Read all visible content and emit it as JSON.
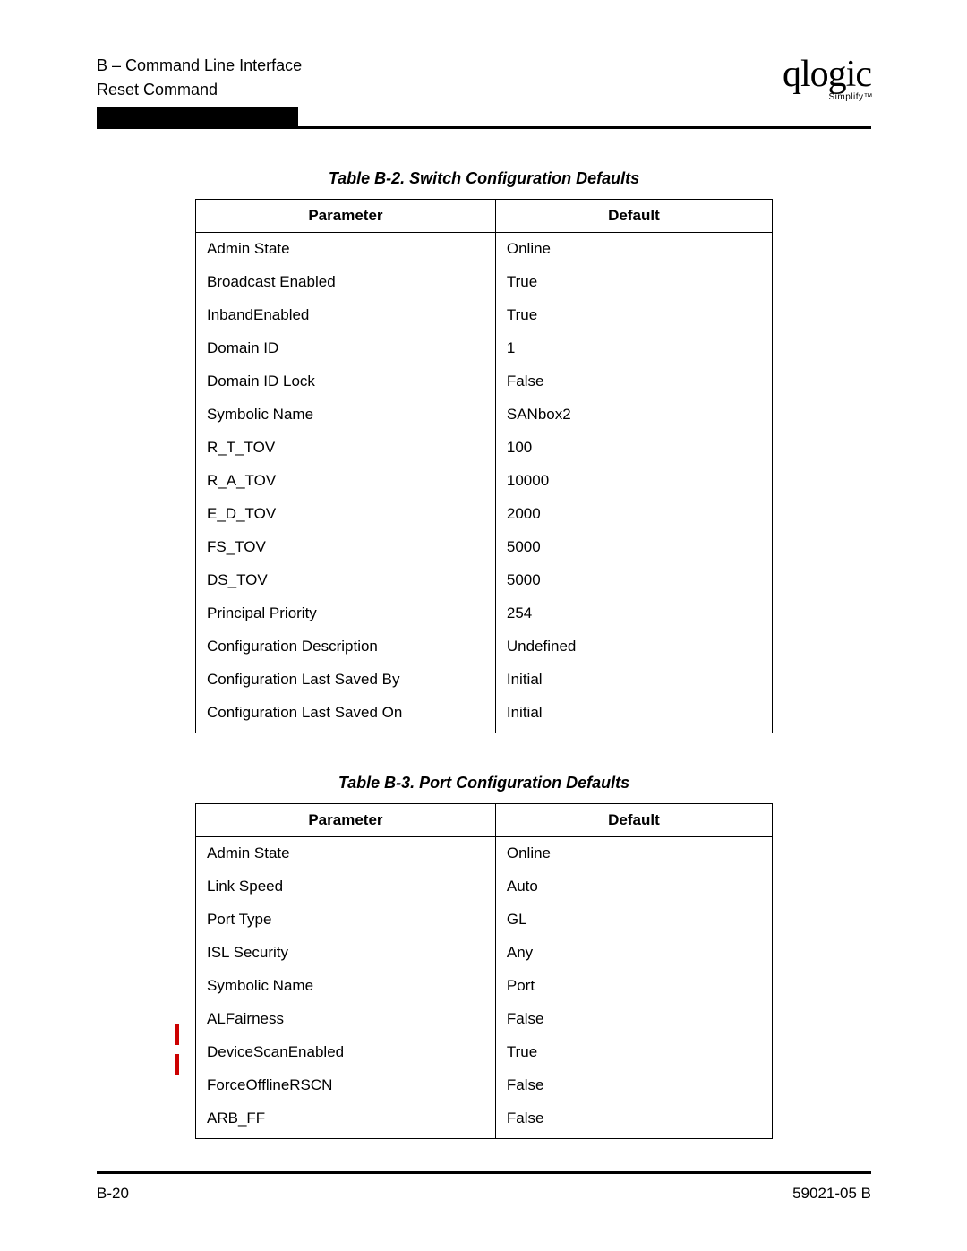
{
  "header": {
    "section": "B – Command Line Interface",
    "title": "Reset Command",
    "brand": "qlogic",
    "brand_sub": "Simplify™"
  },
  "tables": [
    {
      "caption": "Table B-2. Switch Configuration Defaults",
      "col1": "Parameter",
      "col2": "Default",
      "rows": [
        {
          "param": "Admin State",
          "default": "Online"
        },
        {
          "param": "Broadcast Enabled",
          "default": "True"
        },
        {
          "param": "InbandEnabled",
          "default": "True"
        },
        {
          "param": "Domain ID",
          "default": "1"
        },
        {
          "param": "Domain ID Lock",
          "default": "False"
        },
        {
          "param": "Symbolic Name",
          "default": "SANbox2"
        },
        {
          "param": "R_T_TOV",
          "default": "100"
        },
        {
          "param": "R_A_TOV",
          "default": "10000"
        },
        {
          "param": "E_D_TOV",
          "default": "2000"
        },
        {
          "param": "FS_TOV",
          "default": "5000"
        },
        {
          "param": "DS_TOV",
          "default": "5000"
        },
        {
          "param": "Principal Priority",
          "default": "254"
        },
        {
          "param": "Configuration Description",
          "default": "Undefined"
        },
        {
          "param": "Configuration Last Saved By",
          "default": "Initial"
        },
        {
          "param": "Configuration Last Saved On",
          "default": "Initial"
        }
      ]
    },
    {
      "caption": "Table B-3. Port Configuration Defaults",
      "col1": "Parameter",
      "col2": "Default",
      "rows": [
        {
          "param": "Admin State",
          "default": "Online"
        },
        {
          "param": "Link Speed",
          "default": "Auto"
        },
        {
          "param": "Port Type",
          "default": "GL"
        },
        {
          "param": "ISL Security",
          "default": "Any"
        },
        {
          "param": "Symbolic Name",
          "default": "Port"
        },
        {
          "param": "ALFairness",
          "default": "False"
        },
        {
          "param": "DeviceScanEnabled",
          "default": "True",
          "revbar": true
        },
        {
          "param": "ForceOfflineRSCN",
          "default": "False",
          "revbar": true
        },
        {
          "param": "ARB_FF",
          "default": "False"
        }
      ]
    }
  ],
  "footer": {
    "page": "B-20",
    "docnum": "59021-05  B"
  }
}
